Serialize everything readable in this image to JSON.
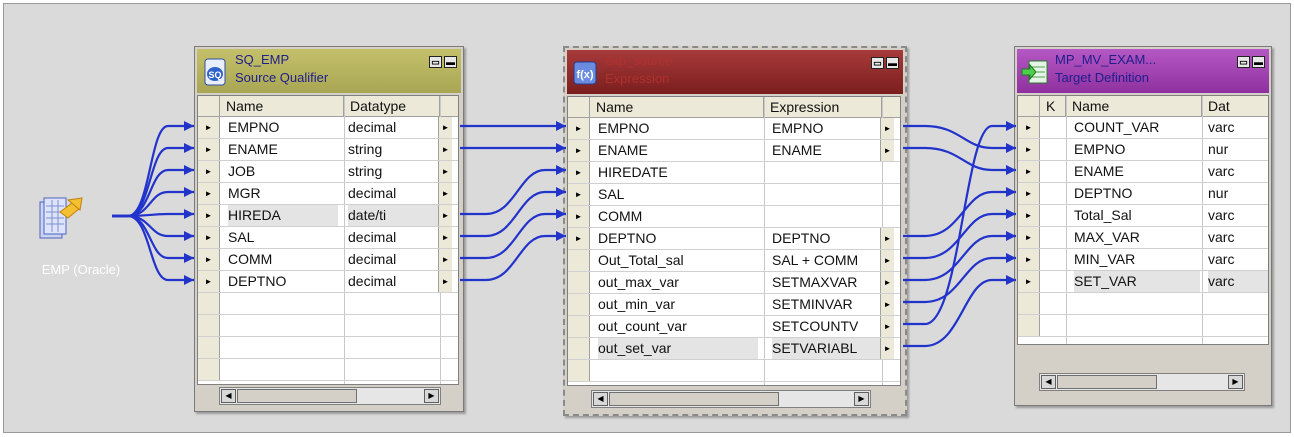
{
  "source": {
    "label": "EMP (Oracle)",
    "icon": "oracle-source-icon"
  },
  "source_qualifier": {
    "name": "SQ_EMP",
    "type": "Source Qualifier",
    "header_color": "#a9a654",
    "columns": [
      "Name",
      "Datatype"
    ],
    "rows": [
      {
        "name": "EMPNO",
        "datatype": "decimal"
      },
      {
        "name": "ENAME",
        "datatype": "string"
      },
      {
        "name": "JOB",
        "datatype": "string"
      },
      {
        "name": "MGR",
        "datatype": "decimal"
      },
      {
        "name": "HIREDA",
        "datatype": "date/ti"
      },
      {
        "name": "SAL",
        "datatype": "decimal"
      },
      {
        "name": "COMM",
        "datatype": "decimal"
      },
      {
        "name": "DEPTNO",
        "datatype": "decimal"
      }
    ],
    "selected_row": "HIREDA"
  },
  "expression": {
    "name": "exp_source",
    "type": "Expression",
    "header_color": "#8c2a2a",
    "columns": [
      "Name",
      "Expression"
    ],
    "rows": [
      {
        "name": "EMPNO",
        "expression": "EMPNO"
      },
      {
        "name": "ENAME",
        "expression": "ENAME"
      },
      {
        "name": "HIREDATE",
        "expression": ""
      },
      {
        "name": "SAL",
        "expression": ""
      },
      {
        "name": "COMM",
        "expression": ""
      },
      {
        "name": "DEPTNO",
        "expression": "DEPTNO"
      },
      {
        "name": "Out_Total_sal",
        "expression": "SAL + COMM"
      },
      {
        "name": "out_max_var",
        "expression": "SETMAXVAR"
      },
      {
        "name": "out_min_var",
        "expression": "SETMINVAR"
      },
      {
        "name": "out_count_var",
        "expression": "SETCOUNTV"
      },
      {
        "name": "out_set_var",
        "expression": "SETVARIABL"
      }
    ],
    "selected_row": "out_set_var"
  },
  "target": {
    "name": "MP_MV_EXAM...",
    "type": "Target Definition",
    "header_color": "#a040b0",
    "columns": [
      "K",
      "Name",
      "Dat"
    ],
    "rows": [
      {
        "name": "COUNT_VAR",
        "datatype": "varc"
      },
      {
        "name": "EMPNO",
        "datatype": "nur"
      },
      {
        "name": "ENAME",
        "datatype": "varc"
      },
      {
        "name": "DEPTNO",
        "datatype": "nur"
      },
      {
        "name": "Total_Sal",
        "datatype": "varc"
      },
      {
        "name": "MAX_VAR",
        "datatype": "varc"
      },
      {
        "name": "MIN_VAR",
        "datatype": "varc"
      },
      {
        "name": "SET_VAR",
        "datatype": "varc"
      }
    ],
    "selected_row": "SET_VAR"
  },
  "window_buttons": {
    "restore": "▭",
    "minimize": "▬"
  },
  "link_color": "#2233cc"
}
